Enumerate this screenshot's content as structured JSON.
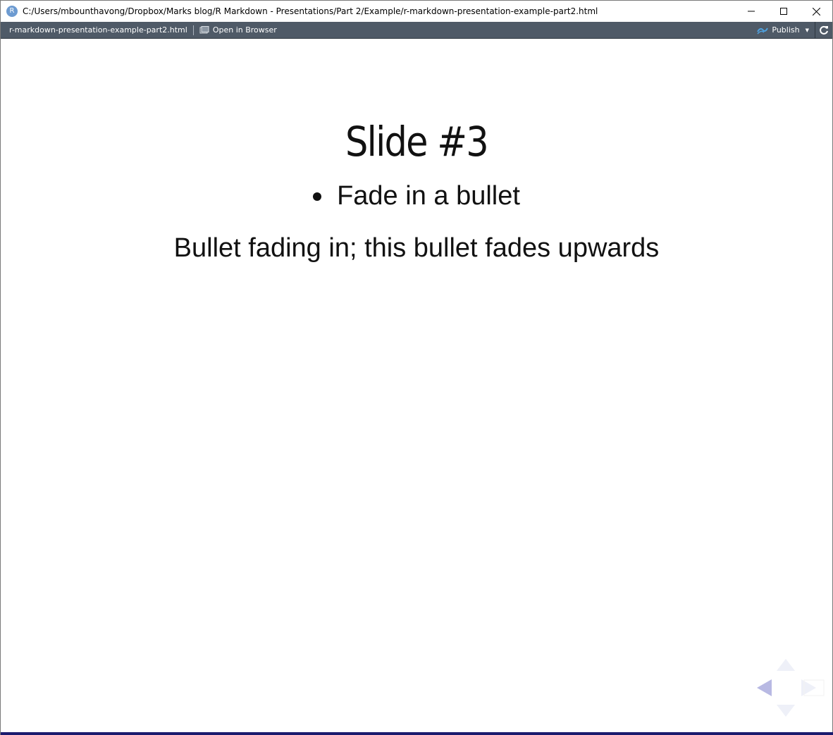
{
  "window": {
    "title": "C:/Users/mbounthavong/Dropbox/Marks blog/R Markdown - Presentations/Part 2/Example/r-markdown-presentation-example-part2.html",
    "app_logo_letter": "R"
  },
  "toolbar": {
    "filename": "r-markdown-presentation-example-part2.html",
    "open_in_browser_label": "Open in Browser",
    "publish_label": "Publish"
  },
  "slide": {
    "title": "Slide #3",
    "bullets": [
      {
        "text": "Fade in a bullet"
      }
    ],
    "paragraph": "Bullet fading in; this bullet fades upwards"
  },
  "colors": {
    "toolbar_bg": "#4f5a67",
    "publish_icon": "#4ea0dd",
    "nav_active": "#b8b9e3",
    "nav_inactive": "#eef0f8",
    "bottom_progress": "#1b1b6e"
  }
}
